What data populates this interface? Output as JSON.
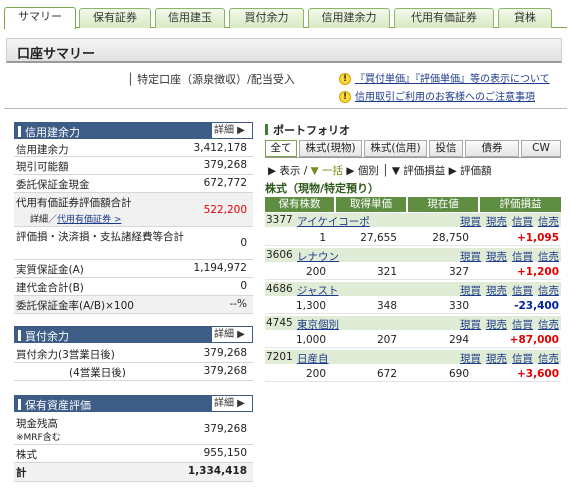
{
  "tabs": [
    {
      "label": "サマリー",
      "active": true
    },
    {
      "label": "保有証券"
    },
    {
      "label": "信用建玉"
    },
    {
      "label": "買付余力"
    },
    {
      "label": "信用建余力"
    },
    {
      "label": "代用有価証券"
    },
    {
      "label": "貸株"
    }
  ],
  "page_title": "口座サマリー",
  "account_type": "│ 特定口座（源泉徴収）/配当受入",
  "notices": [
    "『買付単価』『評価単価』等の表示について",
    "信用取引ご利用のお客様へのご注意事項"
  ],
  "margin_panel": {
    "title": "信用建余力",
    "detail": "詳細 ▶",
    "rows": [
      {
        "label": "信用建余力",
        "value": "3,412,178"
      },
      {
        "label": "現引可能額",
        "value": "379,268"
      },
      {
        "label": "委託保証金現金",
        "value": "672,772"
      },
      {
        "label": "代用有価証券評価額合計",
        "sub": "詳細／",
        "link": "代用有価証券 >",
        "value": "522,200"
      },
      {
        "label": "評価損・決済損・支払諸経費等合計",
        "value": "0"
      },
      {
        "label": "実質保証金(A)",
        "value": "1,194,972"
      },
      {
        "label": "建代金合計(B)",
        "value": "0"
      },
      {
        "label": "委託保証金率(A/B)×100",
        "value": "--%"
      }
    ]
  },
  "buying_panel": {
    "title": "買付余力",
    "detail": "詳細 ▶",
    "rows": [
      {
        "label": "買付余力(3営業日後)",
        "value": "379,268"
      },
      {
        "label": "(4営業日後)",
        "value": "379,268"
      }
    ]
  },
  "assets_panel": {
    "title": "保有資産評価",
    "detail": "詳細 ▶",
    "rows": [
      {
        "label": "現金残高",
        "sub": "※MRF含む",
        "value": "379,268"
      },
      {
        "label": "株式",
        "value": "955,150"
      },
      {
        "label": "計",
        "value": "1,334,418"
      }
    ]
  },
  "portfolio": {
    "title": "ポートフォリオ",
    "tabs": [
      "全て",
      "株式(現物)",
      "株式(信用)",
      "投信",
      "債券",
      "CW"
    ],
    "toolbar": [
      "▶ 表示",
      "/",
      "▼ 一括",
      "▶ 個別",
      "│",
      "▼ 評価損益",
      "▶ 評価額"
    ],
    "section_title": "株式（現物/特定預り）",
    "headers": [
      "保有株数",
      "取得単価",
      "現在値",
      "評価損益"
    ],
    "actions": [
      "現買",
      "現売",
      "信買",
      "信売"
    ],
    "holdings": [
      {
        "code": "3377",
        "name": "アイケイコーポ",
        "shares": "1",
        "cost": "27,655",
        "price": "28,750",
        "pl": "+1,095",
        "sign": "pos"
      },
      {
        "code": "3606",
        "name": "レナウン",
        "shares": "200",
        "cost": "321",
        "price": "327",
        "pl": "+1,200",
        "sign": "pos"
      },
      {
        "code": "4686",
        "name": "ジャスト",
        "shares": "1,300",
        "cost": "348",
        "price": "330",
        "pl": "-23,400",
        "sign": "neg"
      },
      {
        "code": "4745",
        "name": "東京個別",
        "shares": "1,000",
        "cost": "207",
        "price": "294",
        "pl": "+87,000",
        "sign": "pos"
      },
      {
        "code": "7201",
        "name": "日産自",
        "shares": "200",
        "cost": "672",
        "price": "690",
        "pl": "+3,600",
        "sign": "pos"
      }
    ]
  },
  "colors": {
    "header_blue": "#3d5c86",
    "table_green": "#5f8e43",
    "gain": "#e00000",
    "loss": "#0020a0"
  }
}
